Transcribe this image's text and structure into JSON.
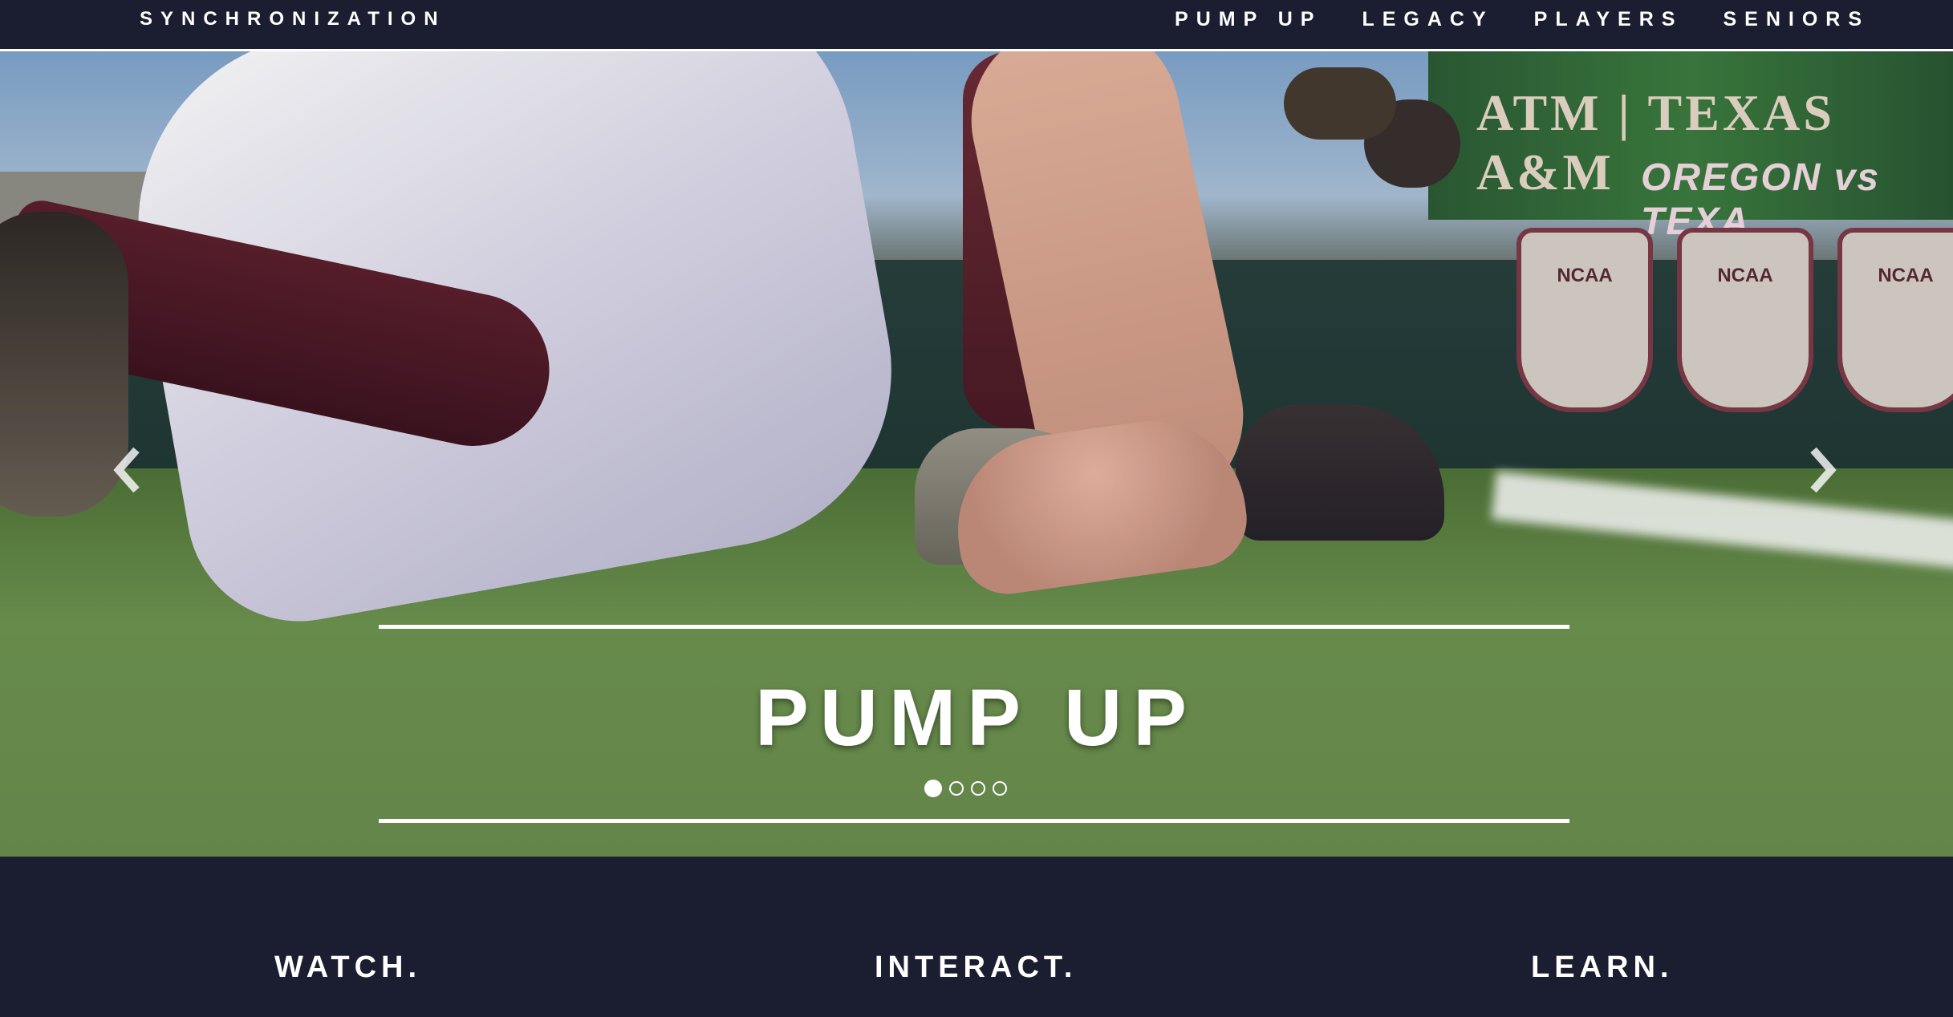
{
  "nav": {
    "brand": "SYNCHRONIZATION",
    "links": [
      "PUMP UP",
      "LEGACY",
      "PLAYERS",
      "SENIORS"
    ]
  },
  "hero": {
    "title": "PUMP UP",
    "slide_count": 4,
    "active_slide": 1,
    "prev_icon": "chevron-left-icon",
    "next_icon": "chevron-right-icon",
    "photo_signage": {
      "scoreboard_main": "ATM | TEXAS A&M",
      "scoreboard_sub": "OREGON vs TEXA",
      "banner_text": "NCAA"
    }
  },
  "sections": [
    "WATCH.",
    "INTERACT.",
    "LEARN."
  ],
  "colors": {
    "background": "#1b1e30",
    "text": "#ffffff",
    "maroon": "#5b1f2d"
  }
}
